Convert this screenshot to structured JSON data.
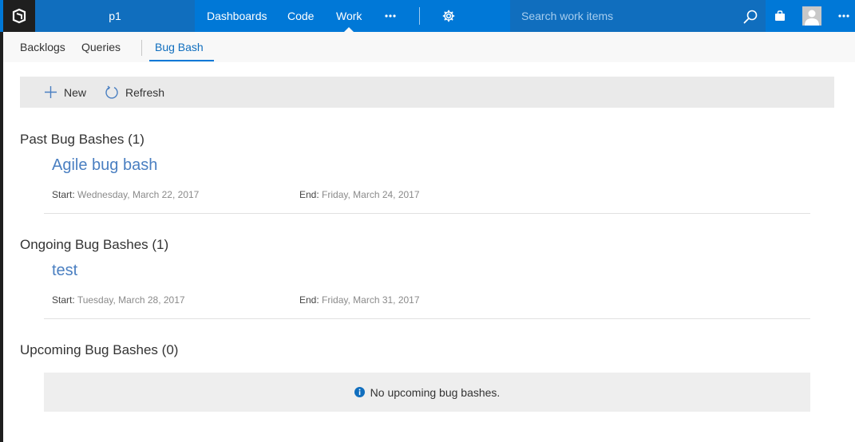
{
  "header": {
    "project_name": "p1",
    "nav": [
      {
        "label": "Dashboards"
      },
      {
        "label": "Code"
      },
      {
        "label": "Work"
      }
    ],
    "active_nav": "Work",
    "search": {
      "placeholder": "Search work items",
      "value": ""
    },
    "icons": {
      "logo": "vsts-logo-icon",
      "more": "ellipsis-icon",
      "settings": "gear-icon",
      "search": "search-icon",
      "marketplace": "shopping-bag-icon",
      "avatar": "user-avatar-icon",
      "user_more": "ellipsis-icon"
    }
  },
  "subnav": {
    "tabs": [
      {
        "label": "Backlogs"
      },
      {
        "label": "Queries"
      },
      {
        "label": "Bug Bash"
      }
    ],
    "active_tab": "Bug Bash"
  },
  "toolbar": {
    "new_label": "New",
    "refresh_label": "Refresh"
  },
  "sections": {
    "past": {
      "title": "Past Bug Bashes (1)",
      "items": [
        {
          "title": "Agile bug bash",
          "start_label": "Start:",
          "start_value": "Wednesday, March 22, 2017",
          "end_label": "End:",
          "end_value": "Friday, March 24, 2017"
        }
      ]
    },
    "ongoing": {
      "title": "Ongoing Bug Bashes (1)",
      "items": [
        {
          "title": "test",
          "start_label": "Start:",
          "start_value": "Tuesday, March 28, 2017",
          "end_label": "End:",
          "end_value": "Friday, March 31, 2017"
        }
      ]
    },
    "upcoming": {
      "title": "Upcoming Bug Bashes (0)",
      "empty_message": "No upcoming bug bashes."
    }
  },
  "colors": {
    "brand": "#0078d7",
    "link": "#4a7fc1",
    "info": "#106ebe"
  }
}
